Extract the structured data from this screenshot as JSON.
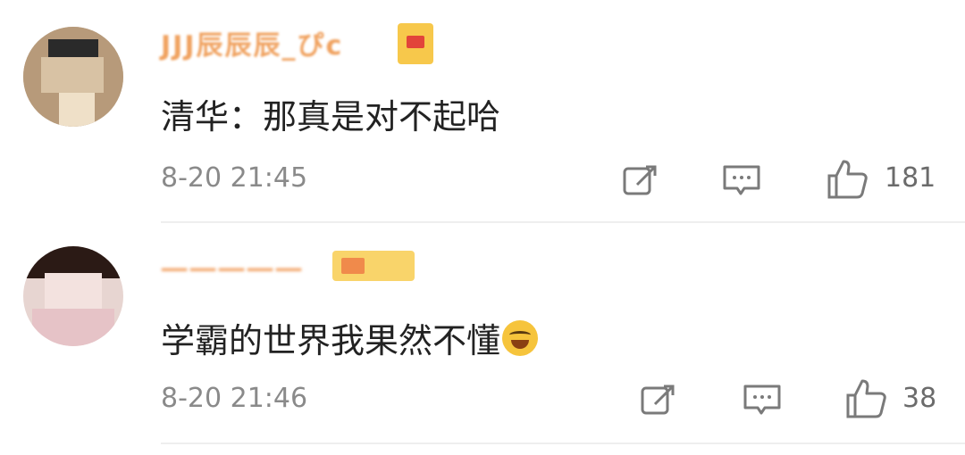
{
  "comments": [
    {
      "username": "JJJ辰辰辰_ぴc",
      "text": "清华：那真是对不起哈",
      "time": "8-20 21:45",
      "like_count": "181",
      "icons": {
        "repost": "repost-icon",
        "reply": "comment-icon",
        "like": "thumbs-up-icon"
      }
    },
    {
      "username": "一一一一一",
      "text": "学霸的世界我果然不懂",
      "time": "8-20 21:46",
      "like_count": "38",
      "icons": {
        "repost": "repost-icon",
        "reply": "comment-icon",
        "like": "thumbs-up-icon"
      },
      "emoji": "grinning-face-emoji"
    }
  ],
  "colors": {
    "username": "#f0a260",
    "text": "#222222",
    "meta": "#8a8a8a",
    "divider": "#eeeeee",
    "badge": "#f7c84b"
  }
}
